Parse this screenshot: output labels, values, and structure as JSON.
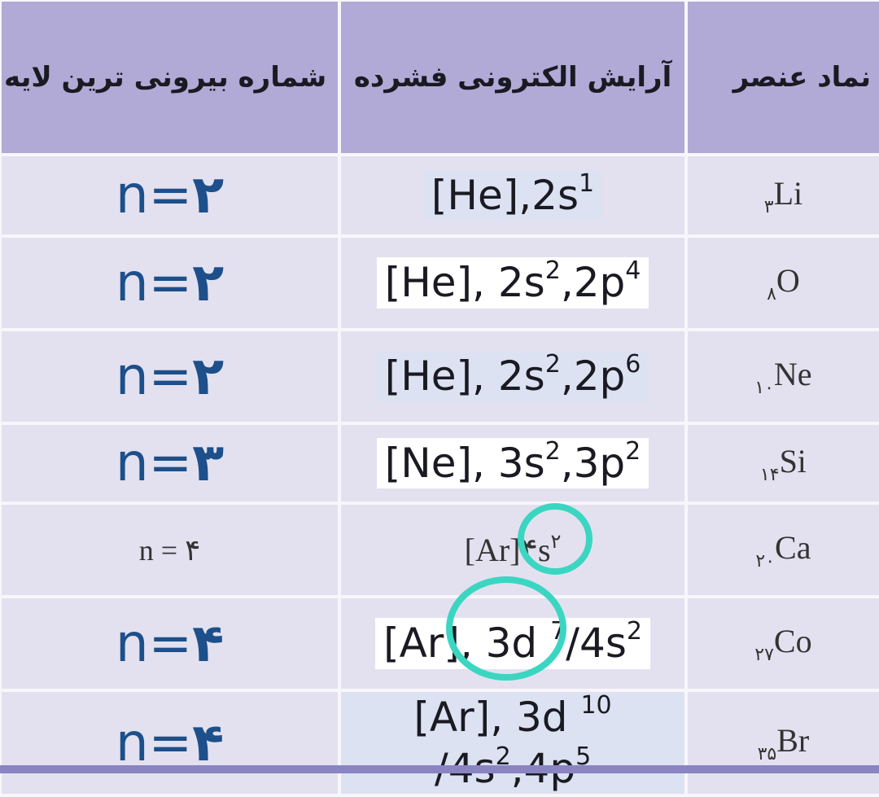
{
  "table": {
    "headers": [
      "شماره بیرونی ترین لایه",
      "آرایش الکترونی فشرده",
      "نماد عنصر"
    ],
    "rows": [
      {
        "atomic_number": "۳",
        "symbol": "Li",
        "config": [
          {
            "t": "[He],2s",
            "s": "1"
          }
        ],
        "shell_n": "n=",
        "shell_v": "۲",
        "style": "bold",
        "highlight": "blue"
      },
      {
        "atomic_number": "۸",
        "symbol": "O",
        "config": [
          {
            "t": "[He], 2s",
            "s": "2"
          },
          {
            "t": ",2p",
            "s": "4"
          }
        ],
        "shell_n": "n=",
        "shell_v": "۲",
        "style": "bold",
        "highlight": "white"
      },
      {
        "atomic_number": "۱۰",
        "symbol": "Ne",
        "config": [
          {
            "t": "[He], 2s",
            "s": "2"
          },
          {
            "t": ",2p",
            "s": "6"
          }
        ],
        "shell_n": "n=",
        "shell_v": "۲",
        "style": "bold",
        "highlight": "blue"
      },
      {
        "atomic_number": "۱۴",
        "symbol": "Si",
        "config": [
          {
            "t": "[Ne], 3s",
            "s": "2"
          },
          {
            "t": ",3p",
            "s": "2"
          }
        ],
        "shell_n": "n=",
        "shell_v": "۳",
        "style": "bold",
        "highlight": "white"
      },
      {
        "atomic_number": "۲۰",
        "symbol": "Ca",
        "config": [
          {
            "t": "[Ar]۴s",
            "s": "۲"
          }
        ],
        "shell_n": "n = ",
        "shell_v": "۴",
        "style": "serif",
        "highlight": "none"
      },
      {
        "atomic_number": "۲۷",
        "symbol": "Co",
        "config": [
          {
            "t": "[Ar], 3d ",
            "s": "7"
          },
          {
            "t": "/4s",
            "s": "2"
          }
        ],
        "shell_n": "n=",
        "shell_v": "۴",
        "style": "bold",
        "highlight": "white"
      },
      {
        "atomic_number": "۳۵",
        "symbol": "Br",
        "config": [
          {
            "t": "[Ar], 3d ",
            "s": "10"
          },
          {
            "t": " /4s",
            "s": "2"
          },
          {
            "t": ",4p",
            "s": "5"
          }
        ],
        "shell_n": "n=",
        "shell_v": "۴",
        "style": "bold",
        "highlight": "blue"
      }
    ]
  },
  "colors": {
    "header_bg": "#b1a9d6",
    "row_bg": "#e3e1ef",
    "shell_text": "#1d4f8a",
    "annotation_circle": "#3ad6c2"
  }
}
